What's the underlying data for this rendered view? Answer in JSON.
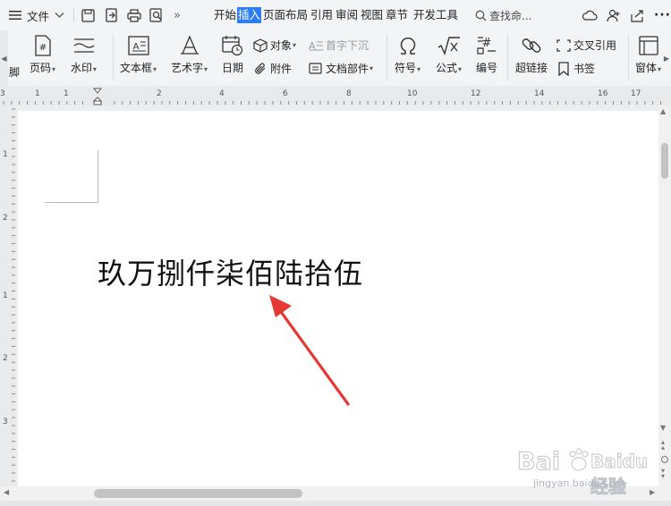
{
  "menu": {
    "file_label": "文件",
    "tabs": [
      {
        "label": "开始",
        "active": false
      },
      {
        "label": "插入",
        "active": true
      },
      {
        "label": "页面布局",
        "active": false
      },
      {
        "label": "引用",
        "active": false
      },
      {
        "label": "审阅",
        "active": false
      },
      {
        "label": "视图",
        "active": false
      },
      {
        "label": "章节",
        "active": false
      },
      {
        "label": "开发工具",
        "active": false
      }
    ],
    "search_text": "查找命..."
  },
  "ribbon": {
    "footer_label": "脚",
    "page_number_label": "页码",
    "watermark_label": "水印",
    "textbox_label": "文本框",
    "wordart_label": "艺术字",
    "date_label": "日期",
    "object_label": "对象",
    "attachment_label": "附件",
    "dropcap_label": "首字下沉",
    "docparts_label": "文档部件",
    "symbol_label": "符号",
    "formula_label": "公式",
    "numbering_label": "编号",
    "hyperlink_label": "超链接",
    "crossref_label": "交叉引用",
    "bookmark_label": "书签",
    "window_label": "窗体"
  },
  "ruler": {
    "h_numbers": [
      "3",
      "1",
      "1",
      "2",
      "4",
      "6",
      "8",
      "10",
      "12",
      "14",
      "16",
      "17"
    ],
    "v_numbers": [
      "1",
      "2",
      "1",
      "2",
      "3"
    ]
  },
  "document": {
    "text": "玖万捌仟柒佰陆拾伍"
  },
  "watermark": {
    "brand": "Baidu经验",
    "url": "jingyan.baidu.com"
  },
  "colors": {
    "accent": "#2e7cf6",
    "arrow": "#e53935",
    "bar_bg": "#f3f4f6",
    "page_bg": "#ffffff"
  }
}
